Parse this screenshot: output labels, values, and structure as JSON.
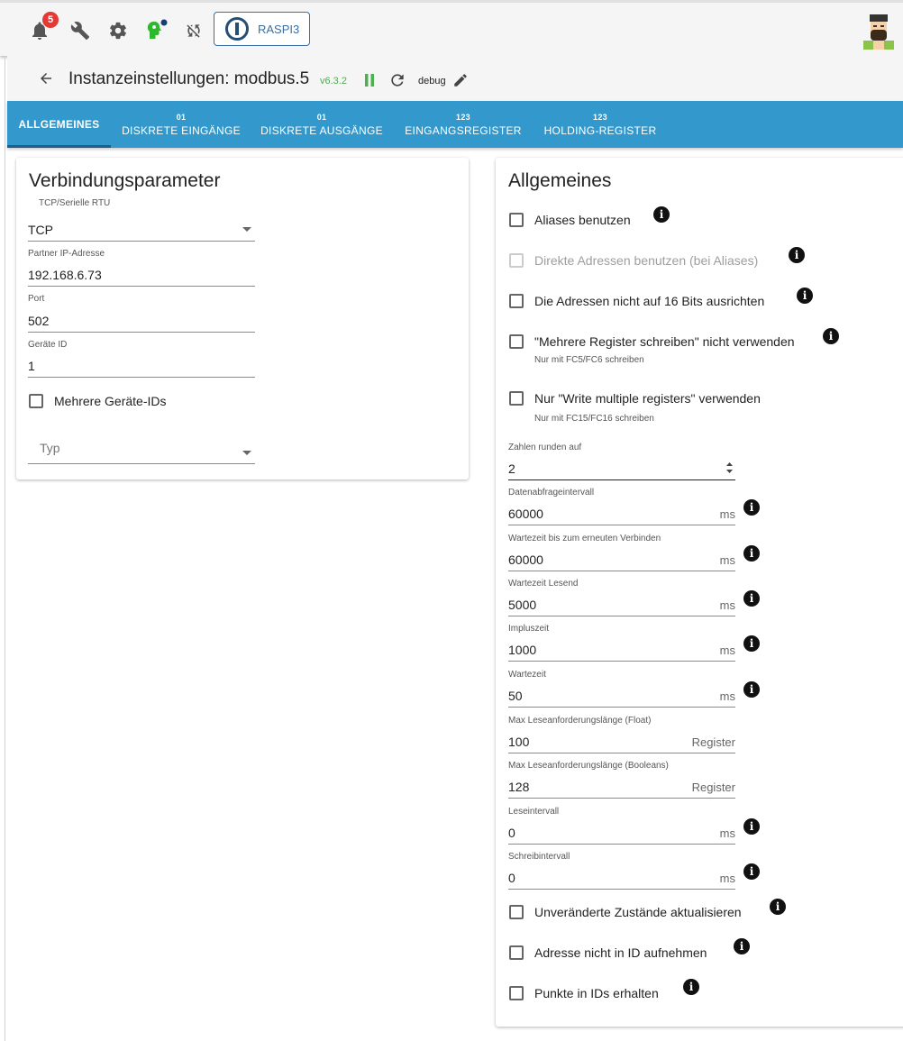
{
  "appbar": {
    "notification_count": "5",
    "host_label": "RASPI3"
  },
  "header": {
    "title": "Instanzeinstellungen: modbus.5",
    "version": "v6.3.2",
    "log_level": "debug"
  },
  "tabs": [
    {
      "num": "",
      "label": "ALLGEMEINES"
    },
    {
      "num": "01",
      "label": "DISKRETE EINGÄNGE"
    },
    {
      "num": "01",
      "label": "DISKRETE AUSGÄNGE"
    },
    {
      "num": "123",
      "label": "EINGANGSREGISTER"
    },
    {
      "num": "123",
      "label": "HOLDING-REGISTER"
    }
  ],
  "left": {
    "title": "Verbindungsparameter",
    "mode_label": "TCP/Serielle RTU",
    "mode_value": "TCP",
    "ip_label": "Partner IP-Adresse",
    "ip_value": "192.168.6.73",
    "port_label": "Port",
    "port_value": "502",
    "device_label": "Geräte ID",
    "device_value": "1",
    "multi_ids_label": "Mehrere Geräte-IDs",
    "type_placeholder": "Typ"
  },
  "right": {
    "title": "Allgemeines",
    "cb_aliases": "Aliases benutzen",
    "cb_direct": "Direkte Adressen benutzen (bei Aliases)",
    "cb_align": "Die Adressen nicht auf 16 Bits ausrichten",
    "cb_multi_write": "\"Mehrere Register schreiben\" nicht verwenden",
    "note_multi_write": "Nur mit FC5/FC6 schreiben",
    "cb_only_multi": "Nur \"Write multiple registers\" verwenden",
    "note_only_multi": "Nur mit FC15/FC16 schreiben",
    "round_label": "Zahlen runden auf",
    "round_value": "2",
    "fields": [
      {
        "label": "Datenabfrageintervall",
        "value": "60000",
        "unit": "ms"
      },
      {
        "label": "Wartezeit bis zum erneuten Verbinden",
        "value": "60000",
        "unit": "ms"
      },
      {
        "label": "Wartezeit Lesend",
        "value": "5000",
        "unit": "ms"
      },
      {
        "label": "Impluszeit",
        "value": "1000",
        "unit": "ms"
      },
      {
        "label": "Wartezeit",
        "value": "50",
        "unit": "ms"
      },
      {
        "label": "Max Leseanforderungslänge (Float)",
        "value": "100",
        "unit": "Register"
      },
      {
        "label": "Max Leseanforderungslänge (Booleans)",
        "value": "128",
        "unit": "Register"
      },
      {
        "label": "Leseintervall",
        "value": "0",
        "unit": "ms"
      },
      {
        "label": "Schreibintervall",
        "value": "0",
        "unit": "ms"
      }
    ],
    "cb_unchanged": "Unveränderte Zustände aktualisieren",
    "cb_no_address": "Adresse nicht in ID aufnehmen",
    "cb_keep_dots": "Punkte in IDs erhalten"
  },
  "colors": {
    "tab_bar": "#3399cc",
    "version_green": "#4caf50",
    "badge_red": "#e53935",
    "admin_green": "#2eb82e"
  }
}
